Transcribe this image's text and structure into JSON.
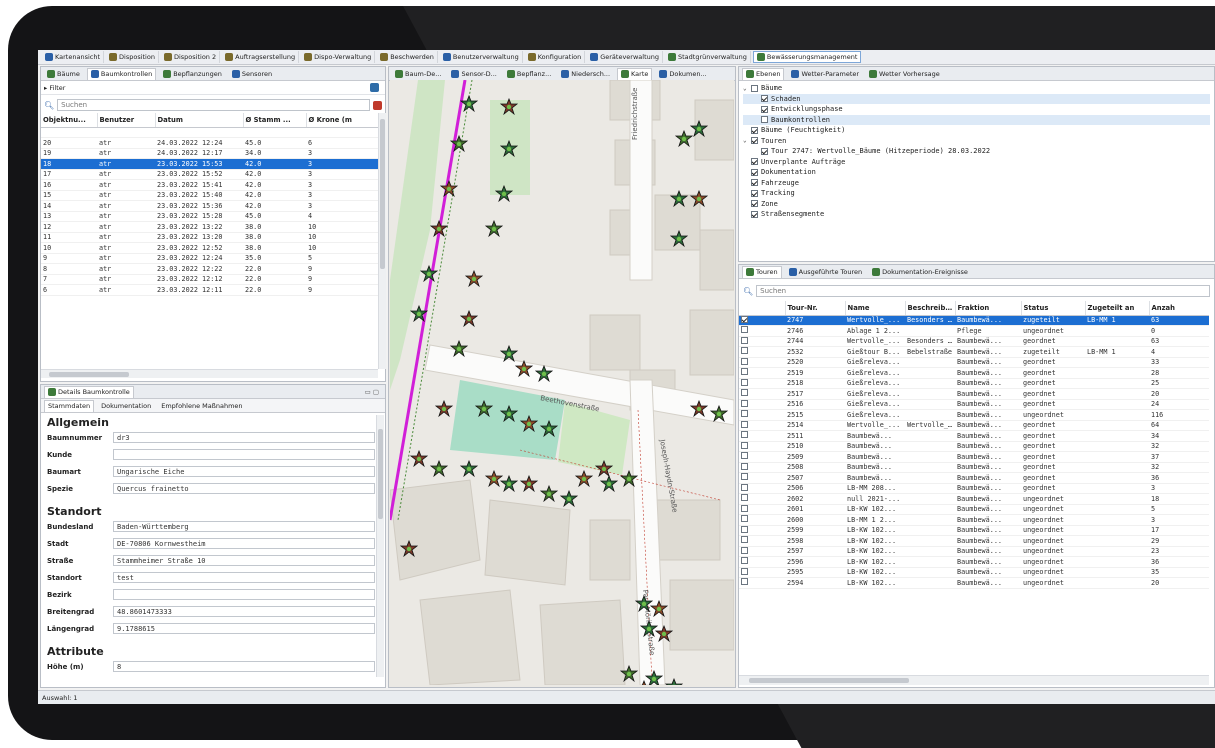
{
  "toolbar": [
    {
      "label": "Kartenansicht",
      "icon": "globe-icon"
    },
    {
      "label": "Disposition",
      "icon": "truck-icon"
    },
    {
      "label": "Disposition 2",
      "icon": "truck-icon"
    },
    {
      "label": "Auftragserstellung",
      "icon": "truck-icon"
    },
    {
      "label": "Dispo-Verwaltung",
      "icon": "truck-icon"
    },
    {
      "label": "Beschwerden",
      "icon": "truck-icon"
    },
    {
      "label": "Benutzerverwaltung",
      "icon": "users-icon"
    },
    {
      "label": "Konfiguration",
      "icon": "gear-icon"
    },
    {
      "label": "Geräteverwaltung",
      "icon": "device-icon"
    },
    {
      "label": "Stadtgrünverwaltung",
      "icon": "tree-icon"
    },
    {
      "label": "Bewässerungsmanagement",
      "icon": "tree-icon",
      "active": true
    }
  ],
  "left_top": {
    "tabs": [
      "Bäume",
      "Baumkontrollen",
      "Bepflanzungen",
      "Sensoren"
    ],
    "filter_label": "Filter",
    "search_placeholder": "Suchen",
    "columns": [
      "Objektnu...",
      "Benutzer",
      "Datum",
      "Ø Stamm ...",
      "Ø Krone (m"
    ],
    "rows": [
      [
        "20",
        "atr",
        "24.03.2022 12:24",
        "45.0",
        "6"
      ],
      [
        "19",
        "atr",
        "24.03.2022 12:17",
        "34.0",
        "3"
      ],
      [
        "18",
        "atr",
        "23.03.2022 15:53",
        "42.0",
        "3"
      ],
      [
        "17",
        "atr",
        "23.03.2022 15:52",
        "42.0",
        "3"
      ],
      [
        "16",
        "atr",
        "23.03.2022 15:41",
        "42.0",
        "3"
      ],
      [
        "15",
        "atr",
        "23.03.2022 15:40",
        "42.0",
        "3"
      ],
      [
        "14",
        "atr",
        "23.03.2022 15:36",
        "42.0",
        "3"
      ],
      [
        "13",
        "atr",
        "23.03.2022 15:28",
        "45.0",
        "4"
      ],
      [
        "12",
        "atr",
        "23.03.2022 13:22",
        "38.0",
        "10"
      ],
      [
        "11",
        "atr",
        "23.03.2022 13:20",
        "38.0",
        "10"
      ],
      [
        "10",
        "atr",
        "23.03.2022 12:52",
        "38.0",
        "10"
      ],
      [
        "9",
        "atr",
        "23.03.2022 12:24",
        "35.0",
        "5"
      ],
      [
        "8",
        "atr",
        "23.03.2022 12:22",
        "22.0",
        "9"
      ],
      [
        "7",
        "atr",
        "23.03.2022 12:12",
        "22.0",
        "9"
      ],
      [
        "6",
        "atr",
        "23.03.2022 12:11",
        "22.0",
        "9"
      ]
    ],
    "selected_row": 2
  },
  "details": {
    "title": "Details Baumkontrolle",
    "tabs": [
      "Stammdaten",
      "Dokumentation",
      "Empfohlene Maßnahmen"
    ],
    "sections": {
      "allgemein": "Allgemein",
      "standort": "Standort",
      "attribute": "Attribute"
    },
    "fields": {
      "baumnummer": {
        "label": "Baumnummer",
        "value": "dr3"
      },
      "kunde": {
        "label": "Kunde",
        "value": ""
      },
      "baumart": {
        "label": "Baumart",
        "value": "Ungarische Eiche"
      },
      "spezie": {
        "label": "Spezie",
        "value": "Quercus frainetto"
      },
      "bundesland": {
        "label": "Bundesland",
        "value": "Baden-Württemberg"
      },
      "stadt": {
        "label": "Stadt",
        "value": "DE-70806 Kornwestheim"
      },
      "strasse": {
        "label": "Straße",
        "value": "Stammheimer Straße 10"
      },
      "standort": {
        "label": "Standort",
        "value": "test"
      },
      "bezirk": {
        "label": "Bezirk",
        "value": ""
      },
      "breitengrad": {
        "label": "Breitengrad",
        "value": "48.8601473333"
      },
      "laengengrad": {
        "label": "Längengrad",
        "value": "9.1788615"
      },
      "hoehe": {
        "label": "Höhe (m)",
        "value": "8"
      }
    }
  },
  "map_tabs": [
    "Baum-De...",
    "Sensor-D...",
    "Bepflanz...",
    "Niedersch...",
    "Karte",
    "Dokumen..."
  ],
  "map_labels": {
    "street1": "Beethovenstraße",
    "street2": "Joseph-Haydn-Straße",
    "street3": "Paul-Mörike-Straße",
    "street4": "Friedrichstraße"
  },
  "layers": {
    "tabs": [
      "Ebenen",
      "Wetter-Parameter",
      "Wetter Vorhersage"
    ],
    "items": [
      {
        "label": "Bäume",
        "checked": false,
        "indent": 0,
        "expander": "v"
      },
      {
        "label": "Schaden",
        "checked": true,
        "indent": 1,
        "highlight": true
      },
      {
        "label": "Entwicklungsphase",
        "checked": true,
        "indent": 1
      },
      {
        "label": "Baumkontrollen",
        "checked": false,
        "indent": 1,
        "highlight": true
      },
      {
        "label": "Bäume (Feuchtigkeit)",
        "checked": true,
        "indent": 0
      },
      {
        "label": "Touren",
        "checked": true,
        "indent": 0,
        "expander": "v"
      },
      {
        "label": "Tour 2747: Wertvolle_Bäume (Hitzeperiode) 28.03.2022",
        "checked": true,
        "indent": 1
      },
      {
        "label": "Unverplante Aufträge",
        "checked": true,
        "indent": 0
      },
      {
        "label": "Dokumentation",
        "checked": true,
        "indent": 0
      },
      {
        "label": "Fahrzeuge",
        "checked": true,
        "indent": 0
      },
      {
        "label": "Tracking",
        "checked": true,
        "indent": 0
      },
      {
        "label": "Zone",
        "checked": true,
        "indent": 0
      },
      {
        "label": "Straßensegmente",
        "checked": true,
        "indent": 0
      }
    ]
  },
  "tours": {
    "tabs": [
      "Touren",
      "Ausgeführte Touren",
      "Dokumentation-Ereignisse"
    ],
    "search_placeholder": "Suchen",
    "columns": [
      "",
      "Tour-Nr.",
      "Name",
      "Beschreib...",
      "Fraktion",
      "Status",
      "Zugeteilt an",
      "Anzah"
    ],
    "rows": [
      [
        "2747",
        "Wertvolle_...",
        "Besonders ...",
        "Baumbewä...",
        "zugeteilt",
        "LB-MM 1",
        "63"
      ],
      [
        "2746",
        "Ablage 1 2...",
        "",
        "Pflege",
        "ungeordnet",
        "",
        "0"
      ],
      [
        "2744",
        "Wertvolle_...",
        "Besonders ...",
        "Baumbewä...",
        "geordnet",
        "",
        "63"
      ],
      [
        "2532",
        "Gießtour B...",
        "Bebelstraße",
        "Baumbewä...",
        "zugeteilt",
        "LB-MM 1",
        "4"
      ],
      [
        "2520",
        "Gießreleva...",
        "",
        "Baumbewä...",
        "geordnet",
        "",
        "33"
      ],
      [
        "2519",
        "Gießreleva...",
        "",
        "Baumbewä...",
        "geordnet",
        "",
        "28"
      ],
      [
        "2518",
        "Gießreleva...",
        "",
        "Baumbewä...",
        "geordnet",
        "",
        "25"
      ],
      [
        "2517",
        "Gießreleva...",
        "",
        "Baumbewä...",
        "geordnet",
        "",
        "20"
      ],
      [
        "2516",
        "Gießreleva...",
        "",
        "Baumbewä...",
        "geordnet",
        "",
        "24"
      ],
      [
        "2515",
        "Gießreleva...",
        "",
        "Baumbewä...",
        "ungeordnet",
        "",
        "116"
      ],
      [
        "2514",
        "Wertvolle_...",
        "Wertvolle_...",
        "Baumbewä...",
        "geordnet",
        "",
        "64"
      ],
      [
        "2511",
        "Baumbewä...",
        "",
        "Baumbewä...",
        "geordnet",
        "",
        "34"
      ],
      [
        "2510",
        "Baumbewä...",
        "",
        "Baumbewä...",
        "geordnet",
        "",
        "32"
      ],
      [
        "2509",
        "Baumbewä...",
        "",
        "Baumbewä...",
        "geordnet",
        "",
        "37"
      ],
      [
        "2508",
        "Baumbewä...",
        "",
        "Baumbewä...",
        "geordnet",
        "",
        "32"
      ],
      [
        "2507",
        "Baumbewä...",
        "",
        "Baumbewä...",
        "geordnet",
        "",
        "36"
      ],
      [
        "2506",
        "LB-MM 208...",
        "",
        "Baumbewä...",
        "geordnet",
        "",
        "3"
      ],
      [
        "2602",
        "null 2021-...",
        "",
        "Baumbewä...",
        "ungeordnet",
        "",
        "18"
      ],
      [
        "2601",
        "LB-KW 102...",
        "",
        "Baumbewä...",
        "ungeordnet",
        "",
        "5"
      ],
      [
        "2600",
        "LB-MM 1 2...",
        "",
        "Baumbewä...",
        "ungeordnet",
        "",
        "3"
      ],
      [
        "2599",
        "LB-KW 102...",
        "",
        "Baumbewä...",
        "ungeordnet",
        "",
        "17"
      ],
      [
        "2598",
        "LB-KW 102...",
        "",
        "Baumbewä...",
        "ungeordnet",
        "",
        "29"
      ],
      [
        "2597",
        "LB-KW 102...",
        "",
        "Baumbewä...",
        "ungeordnet",
        "",
        "23"
      ],
      [
        "2596",
        "LB-KW 102...",
        "",
        "Baumbewä...",
        "ungeordnet",
        "",
        "36"
      ],
      [
        "2595",
        "LB-KW 102...",
        "",
        "Baumbewä...",
        "ungeordnet",
        "",
        "35"
      ],
      [
        "2594",
        "LB-KW 102...",
        "",
        "Baumbewä...",
        "ungeordnet",
        "",
        "20"
      ]
    ],
    "selected_row": 0
  },
  "status_bar": "Auswahl: 1"
}
